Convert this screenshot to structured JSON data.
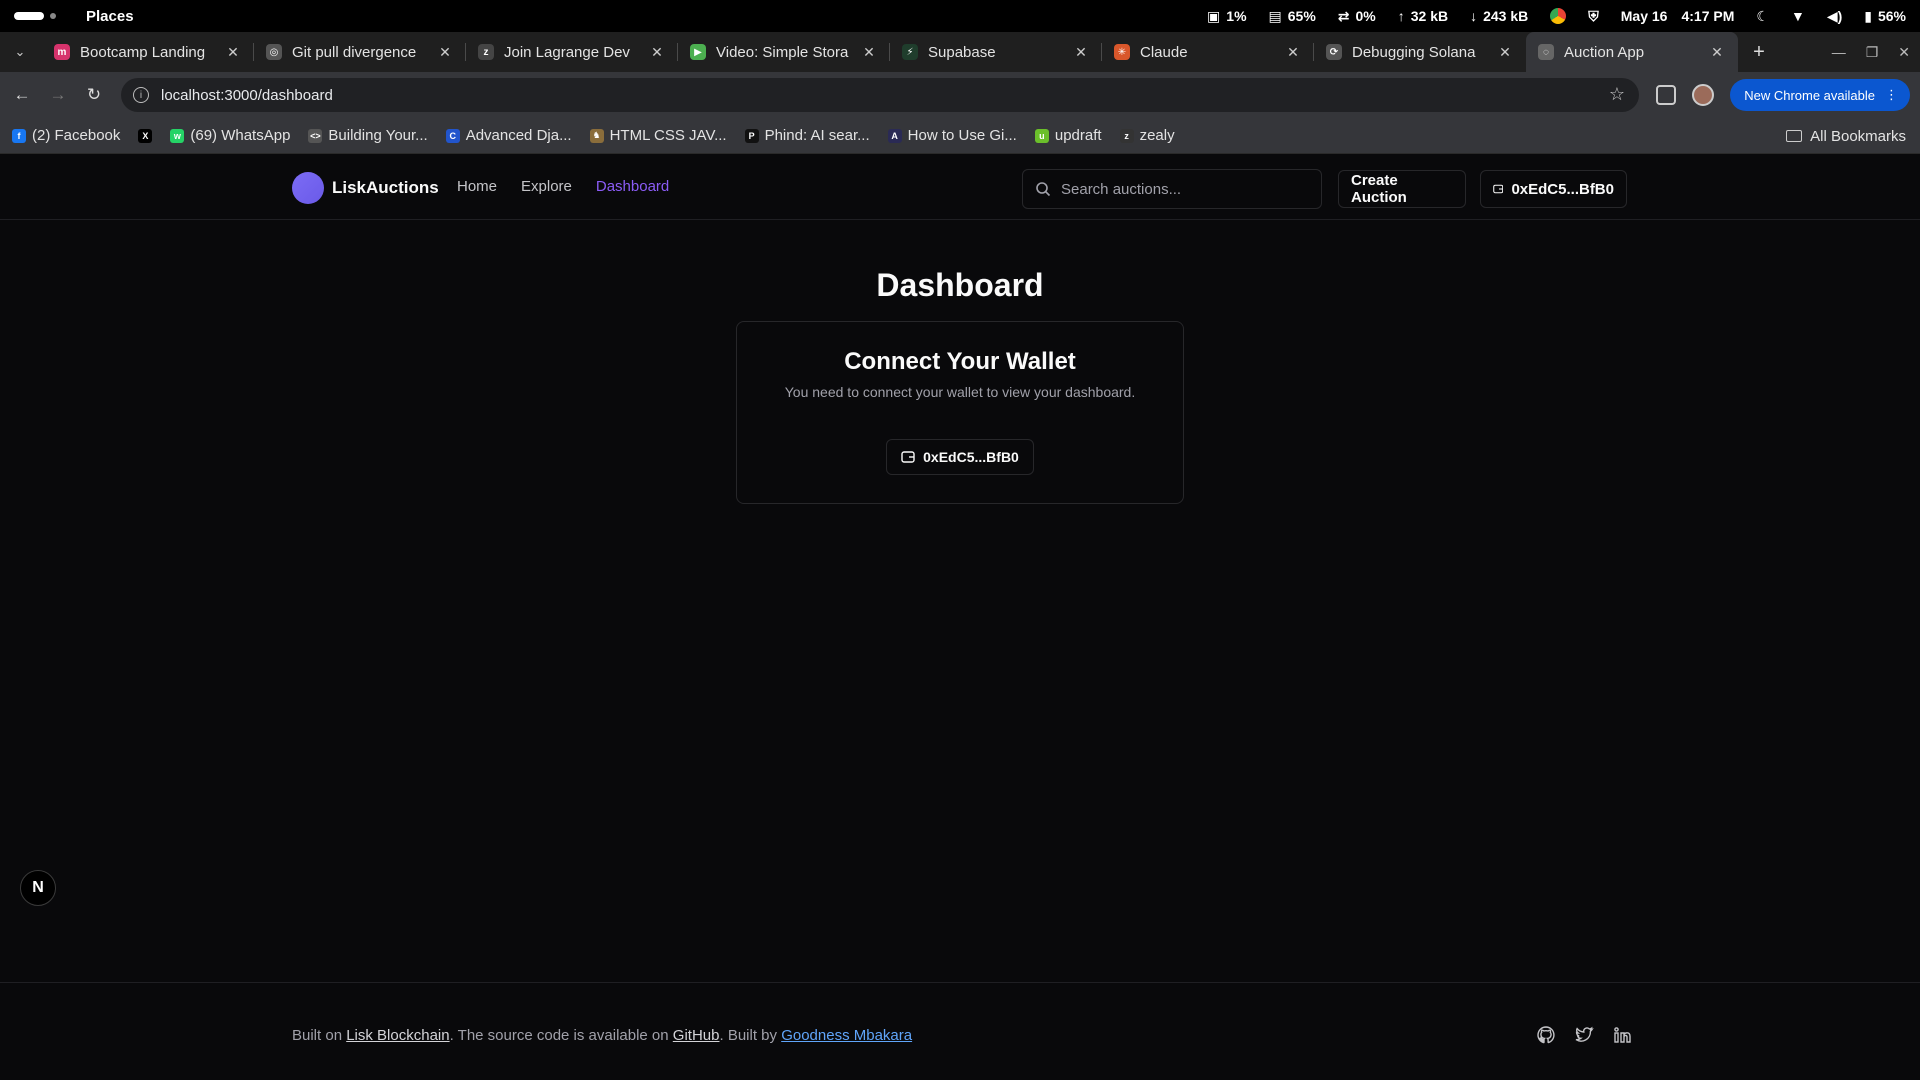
{
  "os": {
    "places": "Places",
    "cpu": "1%",
    "mem": "65%",
    "swap": "0%",
    "up": "32 kB",
    "down": "243 kB",
    "date": "May 16",
    "time": "4:17 PM",
    "battery": "56%"
  },
  "tabs": [
    {
      "title": "Bootcamp Landing",
      "color": "#d6336c",
      "glyph": "m"
    },
    {
      "title": "Git pull divergence",
      "color": "#555555",
      "glyph": "◎"
    },
    {
      "title": "Join Lagrange Dev",
      "color": "#444444",
      "glyph": "z"
    },
    {
      "title": "Video: Simple Stora",
      "color": "#4caf50",
      "glyph": "▶"
    },
    {
      "title": "Supabase",
      "color": "#1f3d2c",
      "glyph": "⚡"
    },
    {
      "title": "Claude",
      "color": "#d9572b",
      "glyph": "✳"
    },
    {
      "title": "Debugging Solana",
      "color": "#555555",
      "glyph": "⟳"
    },
    {
      "title": "Auction App",
      "color": "#666666",
      "glyph": "◌"
    }
  ],
  "address": {
    "url": "localhost:3000/dashboard",
    "update_label": "New Chrome available"
  },
  "bookmarks": [
    {
      "label": "(2) Facebook",
      "color": "#1877f2",
      "glyph": "f"
    },
    {
      "label": "",
      "color": "#000000",
      "glyph": "X"
    },
    {
      "label": "(69) WhatsApp",
      "color": "#25d366",
      "glyph": "w"
    },
    {
      "label": "Building Your...",
      "color": "#555555",
      "glyph": "<>"
    },
    {
      "label": "Advanced Dja...",
      "color": "#2255cc",
      "glyph": "C"
    },
    {
      "label": "HTML CSS JAV...",
      "color": "#8a6d3b",
      "glyph": "♞"
    },
    {
      "label": "Phind: AI sear...",
      "color": "#111111",
      "glyph": "P"
    },
    {
      "label": "How to Use Gi...",
      "color": "#2a2a55",
      "glyph": "A"
    },
    {
      "label": "updraft",
      "color": "#6bbf2b",
      "glyph": "u"
    },
    {
      "label": "zealy",
      "color": "#333333",
      "glyph": "z"
    }
  ],
  "all_bookmarks": "All Bookmarks",
  "site": {
    "brand": "LiskAuctions",
    "nav": [
      "Home",
      "Explore",
      "Dashboard"
    ],
    "search_placeholder": "Search auctions...",
    "create_label": "Create Auction",
    "wallet_label": "0xEdC5...BfB0"
  },
  "dashboard": {
    "title": "Dashboard",
    "card_title": "Connect Your Wallet",
    "card_desc": "You need to connect your wallet to view your dashboard.",
    "wallet_label": "0xEdC5...BfB0"
  },
  "footer": {
    "p1": "Built on ",
    "lisk": "Lisk Blockchain",
    "p2": ". The source code is available on ",
    "github": "GitHub",
    "p3": ". Built by ",
    "author": "Goodness Mbakara"
  },
  "badge": "N"
}
